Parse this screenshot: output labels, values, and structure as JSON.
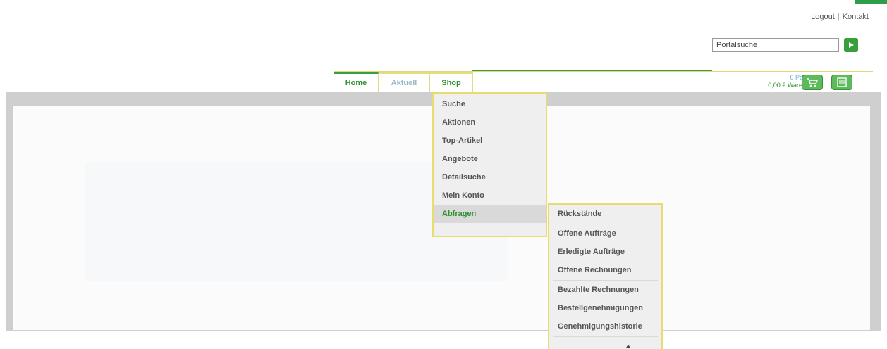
{
  "header": {
    "logout": "Logout",
    "kontakt": "Kontakt",
    "separator": "|"
  },
  "search": {
    "value": "Portalsuche",
    "go_icon": "play-arrow-icon"
  },
  "nav": {
    "tabs": [
      "Home",
      "Aktuell",
      "Shop"
    ]
  },
  "cart": {
    "positions": "0 Position",
    "value": "0,00 € Warenwert",
    "icons": [
      "cart-icon",
      "document-icon"
    ]
  },
  "shop_menu": {
    "items": [
      "Suche",
      "Aktionen",
      "Top-Artikel",
      "Angebote",
      "Detailsuche",
      "Mein Konto",
      "Abfragen"
    ],
    "active": "Abfragen"
  },
  "abfragen_submenu": {
    "items": [
      "Rückstände",
      "Offene Aufträge",
      "Erledigte Aufträge",
      "Offene Rechnungen",
      "Bezahlte Rechnungen",
      "Bestellgenehmigungen",
      "Genehmigungshistorie"
    ]
  },
  "colors": {
    "accent_green": "#3a9e3c",
    "menu_border_yellow": "#e7dc6e",
    "link_blue": "#6aaacb"
  }
}
